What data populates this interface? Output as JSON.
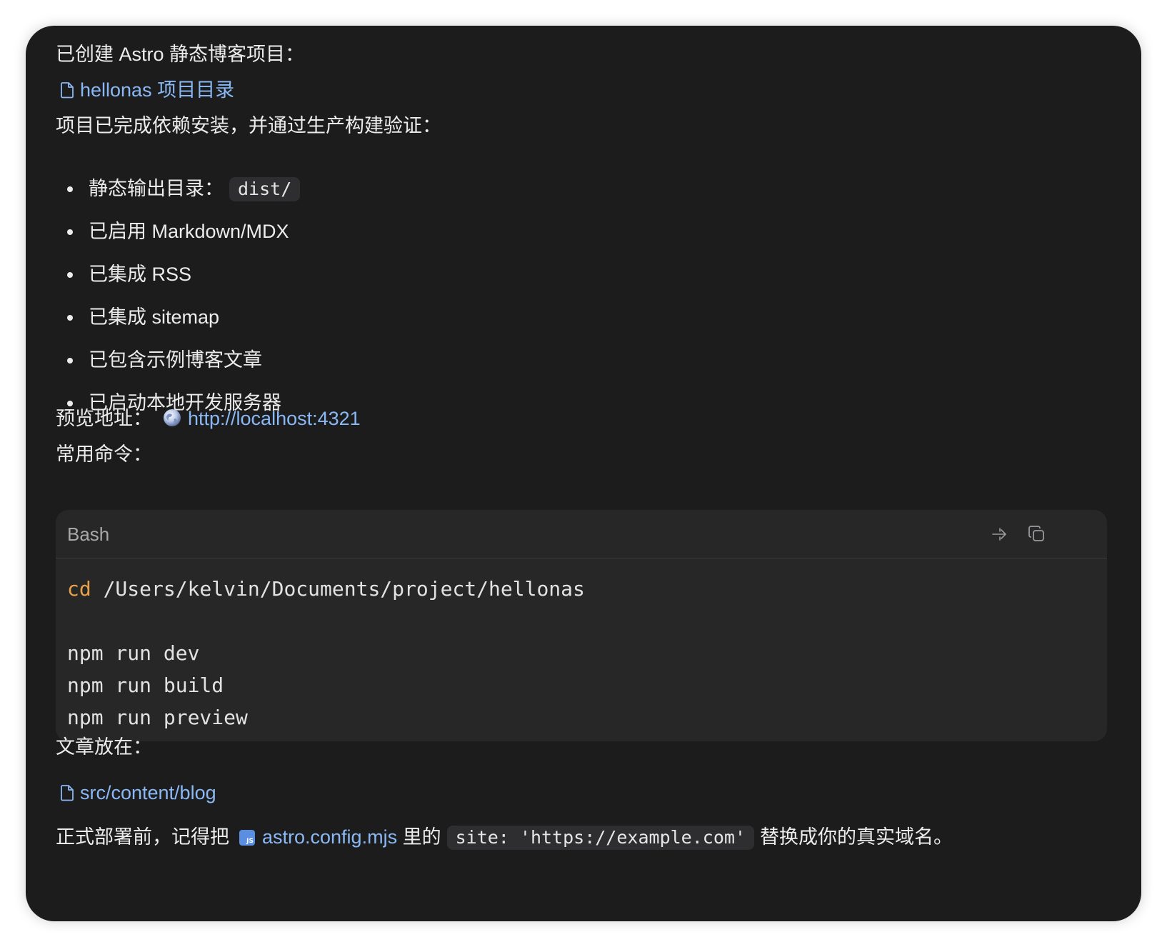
{
  "intro": "已创建 Astro 静态博客项目：",
  "project_link": "hellonas 项目目录",
  "verified": "项目已完成依赖安装，并通过生产构建验证：",
  "bullets": {
    "output_label": "静态输出目录：",
    "output_code": "dist/",
    "markdown": "已启用 Markdown/MDX",
    "rss": "已集成 RSS",
    "sitemap": "已集成 sitemap",
    "sample": "已包含示例博客文章",
    "devserver": "已启动本地开发服务器"
  },
  "preview": {
    "label": "预览地址：",
    "url": "http://localhost:4321"
  },
  "commands_label": "常用命令：",
  "code": {
    "language": "Bash",
    "cd_kw": "cd",
    "cd_path": " /Users/kelvin/Documents/project/hellonas",
    "line_dev": "npm run dev",
    "line_build": "npm run build",
    "line_preview": "npm run preview",
    "icons": {
      "apply": "arrow-right-icon",
      "copy": "copy-icon"
    }
  },
  "posts_label": "文章放在：",
  "posts_link": "src/content/blog",
  "deploy": {
    "before": "正式部署前，记得把",
    "config_link": "astro.config.mjs",
    "mid": "里的",
    "site_code": "site: 'https://example.com'",
    "after": "替换成你的真实域名。"
  },
  "colors": {
    "background": "#1c1c1d",
    "link": "#8ab8f5",
    "keyword": "#e7a34a",
    "code_bg": "#272728"
  }
}
